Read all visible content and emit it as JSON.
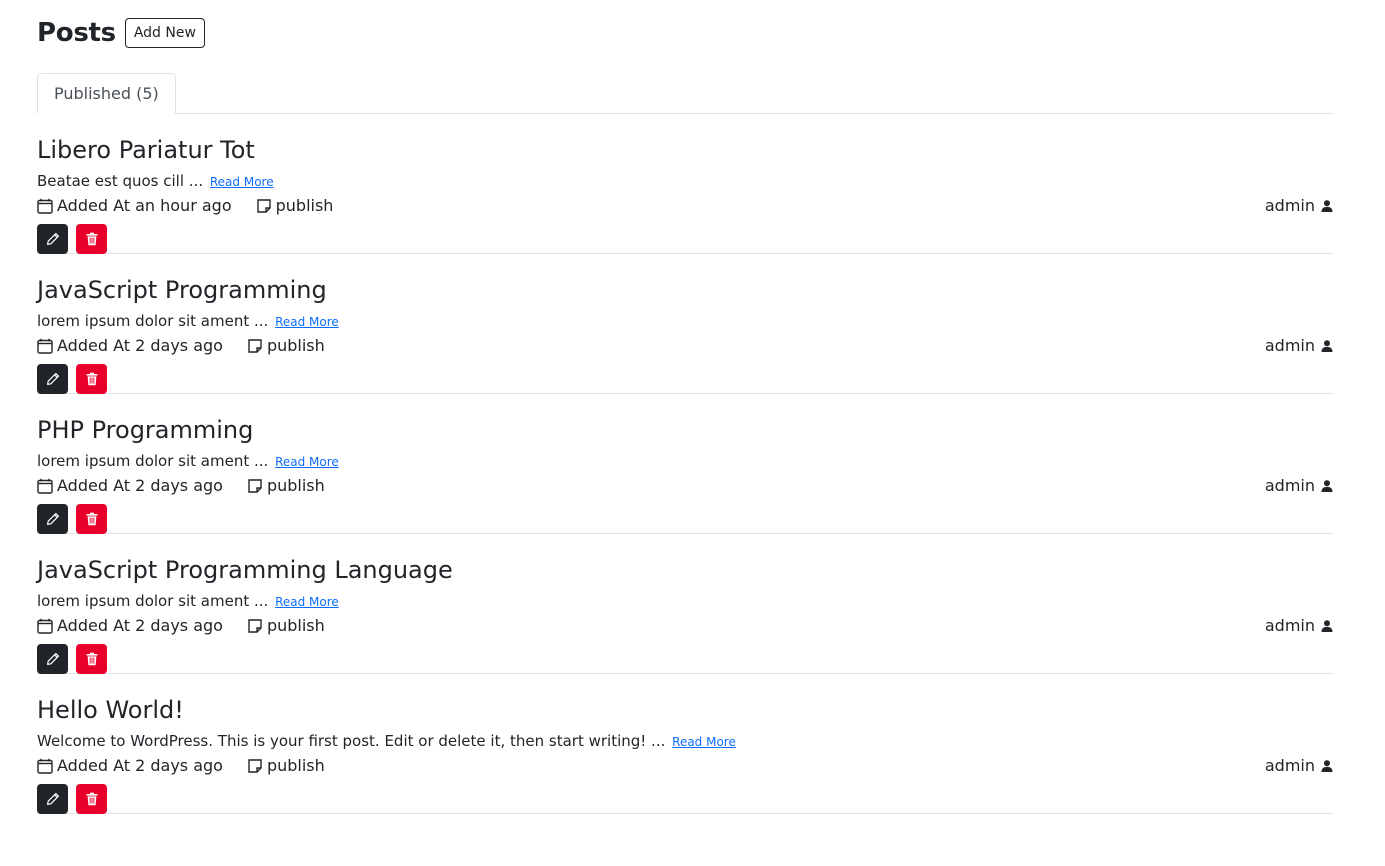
{
  "header": {
    "title": "Posts",
    "add_new_label": "Add New"
  },
  "tabs": [
    {
      "label": "Published (5)",
      "active": true
    }
  ],
  "posts": [
    {
      "title": "Libero Pariatur Tot",
      "excerpt": "Beatae est quos cill ...",
      "read_more": "Read More",
      "added": "Added At an hour ago",
      "status": "publish",
      "author": "admin"
    },
    {
      "title": "JavaScript Programming",
      "excerpt": "lorem ipsum dolor sit ament ...",
      "read_more": "Read More",
      "added": "Added At 2 days ago",
      "status": "publish",
      "author": "admin"
    },
    {
      "title": "PHP Programming",
      "excerpt": "lorem ipsum dolor sit ament ...",
      "read_more": "Read More",
      "added": "Added At 2 days ago",
      "status": "publish",
      "author": "admin"
    },
    {
      "title": "JavaScript Programming Language",
      "excerpt": "lorem ipsum dolor sit ament ...",
      "read_more": "Read More",
      "added": "Added At 2 days ago",
      "status": "publish",
      "author": "admin"
    },
    {
      "title": "Hello World!",
      "excerpt": "Welcome to WordPress. This is your first post. Edit or delete it, then start writing! ...",
      "read_more": "Read More",
      "added": "Added At 2 days ago",
      "status": "publish",
      "author": "admin"
    }
  ],
  "icons": {
    "calendar": "calendar-icon",
    "status": "sticky-note-icon",
    "author": "person-icon",
    "edit": "pencil-icon",
    "delete": "trash-icon"
  },
  "colors": {
    "edit_button": "#212529",
    "delete_button": "#e8002b",
    "link": "#0d6efd"
  }
}
